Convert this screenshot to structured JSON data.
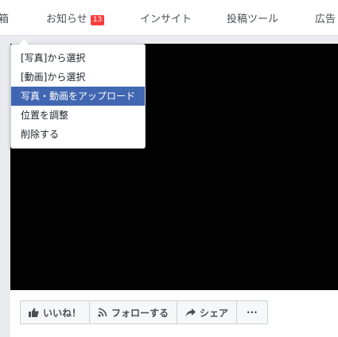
{
  "nav": {
    "items": [
      "箱",
      "お知らせ",
      "インサイト",
      "投稿ツール",
      "広告"
    ],
    "notification_count": "13"
  },
  "cover": {
    "camera_icon": "camera-icon"
  },
  "menu": {
    "items": [
      "[写真]から選択",
      "[動画]から選択",
      "写真・動画をアップロード",
      "位置を調整",
      "削除する"
    ],
    "active_index": 2
  },
  "actions": {
    "like_label": "いいね！",
    "follow_label": "フォローする",
    "share_label": "シェア",
    "more_label": "···"
  },
  "colors": {
    "accent": "#4267b2",
    "badge": "#fa3e3e",
    "cover_bg": "#020202"
  }
}
